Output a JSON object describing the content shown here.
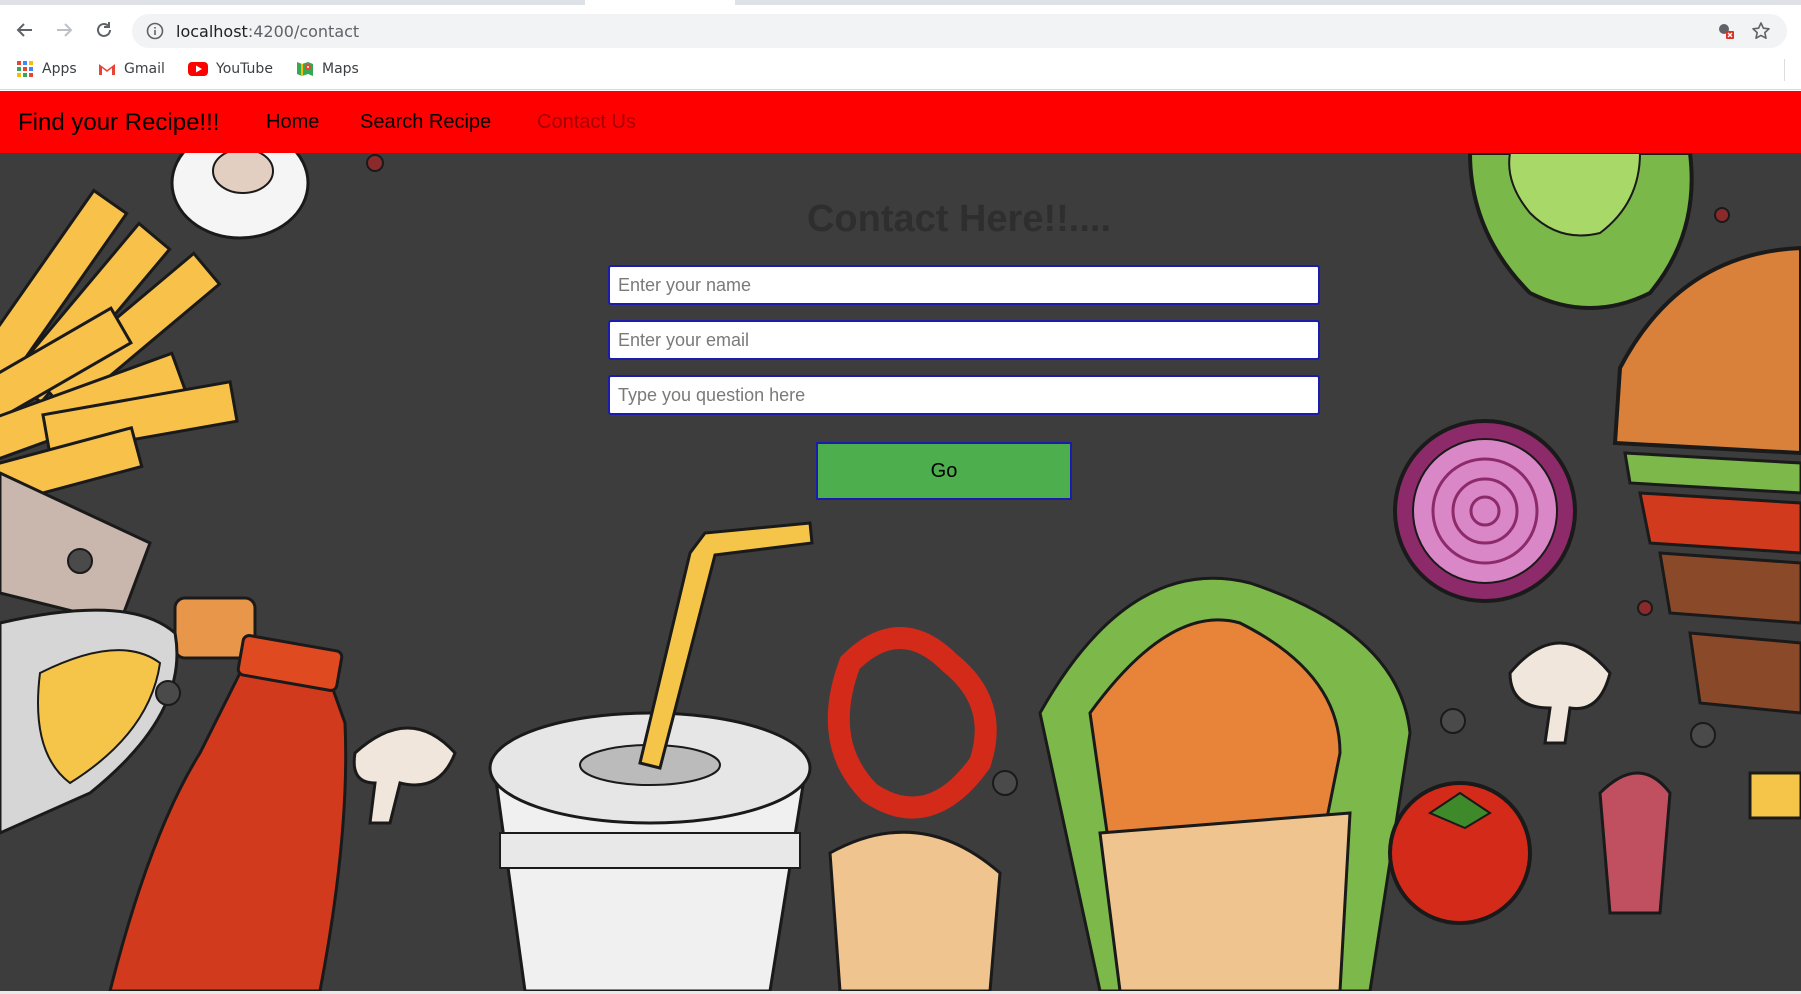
{
  "browser": {
    "url_host": "localhost",
    "url_path": ":4200/contact",
    "icons": {
      "back": "back-arrow-icon",
      "forward": "forward-arrow-icon",
      "reload": "reload-icon",
      "info": "info-icon",
      "blocked": "blocked-content-icon",
      "star": "star-icon"
    }
  },
  "bookmarks": [
    {
      "label": "Apps",
      "icon": "apps-grid-icon"
    },
    {
      "label": "Gmail",
      "icon": "gmail-icon"
    },
    {
      "label": "YouTube",
      "icon": "youtube-icon"
    },
    {
      "label": "Maps",
      "icon": "maps-icon"
    }
  ],
  "navbar": {
    "brand": "Find your Recipe!!!",
    "links": [
      {
        "label": "Home",
        "active": false
      },
      {
        "label": "Search Recipe",
        "active": false
      },
      {
        "label": "Contact Us",
        "active": true
      }
    ],
    "background": "#ff0000"
  },
  "contact": {
    "title": "Contact Here!!....",
    "name_placeholder": "Enter your name",
    "email_placeholder": "Enter your email",
    "question_placeholder": "Type you question here",
    "submit_label": "Go",
    "submit_color": "#4cae4c"
  }
}
